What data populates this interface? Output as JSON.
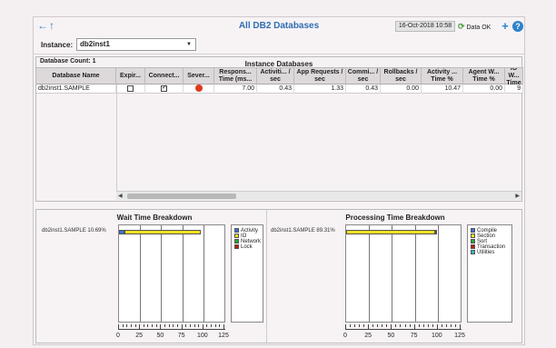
{
  "header": {
    "title": "All DB2 Databases",
    "datetime": "16-Oct-2018 10:58",
    "status": "Data OK",
    "icons": [
      "back-arrow-icon",
      "up-arrow-icon",
      "refresh-icon",
      "add-icon",
      "help-icon"
    ]
  },
  "instance": {
    "label": "Instance:",
    "value": "db2inst1"
  },
  "table": {
    "count_label": "Database Count:",
    "count": "1",
    "caption": "Instance Databases",
    "columns": [
      "Database Name",
      "Expir...",
      "Connect...",
      "Sever...",
      "Respons... Time (ms...",
      "Activiti... / sec",
      "App Requests / sec",
      "Commi... / sec",
      "Rollbacks / sec",
      "Activity ... Time %",
      "Agent W... Time %",
      "IO W... Time"
    ],
    "rows": [
      {
        "name": "db2inst1.SAMPLE",
        "expired": false,
        "connected": true,
        "severity": "critical",
        "response_time": "7.00",
        "activities": "0.43",
        "app_requests": "1.33",
        "commits": "0.43",
        "rollbacks": "0.00",
        "activity_time": "10.47",
        "agent_wait": "0.00",
        "io_wait": "9"
      }
    ]
  },
  "charts": {
    "wait": {
      "title": "Wait Time Breakdown",
      "category_label": "db2inst1.SAMPLE 10.69%",
      "legend": [
        {
          "name": "Activity",
          "color": "#3b6fd6"
        },
        {
          "name": "IO",
          "color": "#f0e020"
        },
        {
          "name": "Network",
          "color": "#22aa33"
        },
        {
          "name": "Lock",
          "color": "#c01818"
        }
      ],
      "ticks": [
        "0",
        "25",
        "50",
        "75",
        "100",
        "125"
      ]
    },
    "processing": {
      "title": "Processing Time Breakdown",
      "category_label": "db2inst1.SAMPLE 89.31%",
      "legend": [
        {
          "name": "Compile",
          "color": "#3b6fd6"
        },
        {
          "name": "Section",
          "color": "#f0e020"
        },
        {
          "name": "Sort",
          "color": "#22aa33"
        },
        {
          "name": "Transaction",
          "color": "#c01818"
        },
        {
          "name": "Utilities",
          "color": "#30b8c8"
        }
      ],
      "ticks": [
        "0",
        "25",
        "50",
        "75",
        "100",
        "125"
      ]
    }
  },
  "chart_data": [
    {
      "type": "bar",
      "title": "Wait Time Breakdown",
      "categories": [
        "db2inst1.SAMPLE 10.69%"
      ],
      "series": [
        {
          "name": "Activity",
          "values": [
            6.5
          ]
        },
        {
          "name": "IO",
          "values": [
            90
          ]
        },
        {
          "name": "Network",
          "values": [
            0
          ]
        },
        {
          "name": "Lock",
          "values": [
            0
          ]
        }
      ],
      "xlim": [
        0,
        125
      ],
      "stacked": true,
      "orientation": "horizontal"
    },
    {
      "type": "bar",
      "title": "Processing Time Breakdown",
      "categories": [
        "db2inst1.SAMPLE 89.31%"
      ],
      "series": [
        {
          "name": "Compile",
          "values": [
            0
          ]
        },
        {
          "name": "Section",
          "values": [
            97
          ]
        },
        {
          "name": "Sort",
          "values": [
            0
          ]
        },
        {
          "name": "Transaction",
          "values": [
            1.5
          ]
        },
        {
          "name": "Utilities",
          "values": [
            0
          ]
        }
      ],
      "xlim": [
        0,
        125
      ],
      "stacked": true,
      "orientation": "horizontal"
    }
  ]
}
